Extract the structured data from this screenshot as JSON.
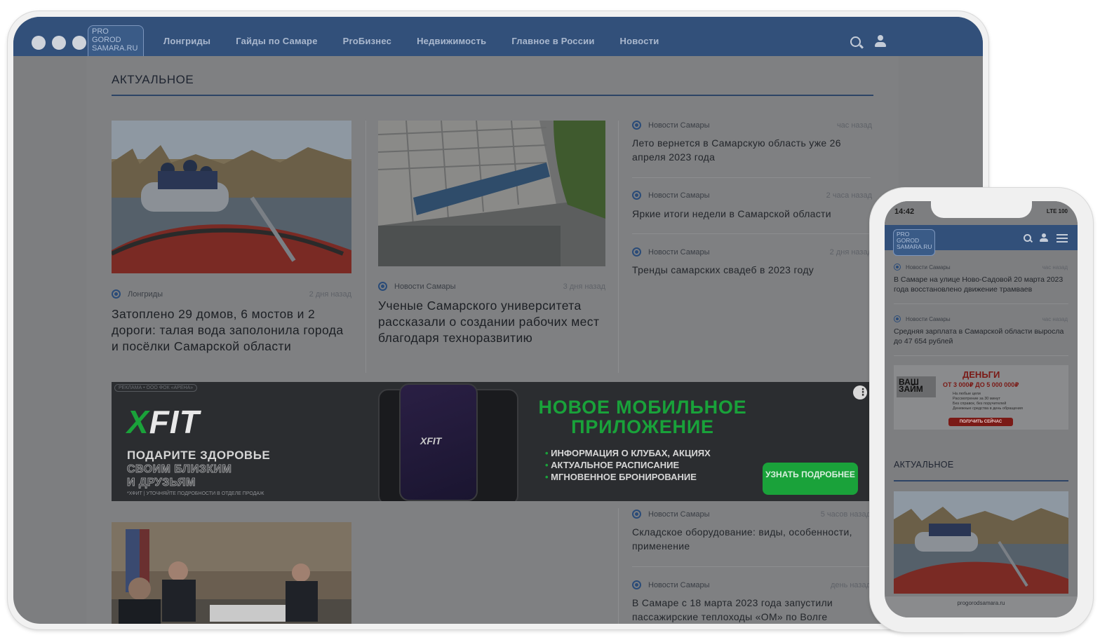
{
  "desktop": {
    "logo": "PRO GOROD SAMARA.RU",
    "nav": [
      "Лонгриды",
      "Гайды по Самаре",
      "ProБизнес",
      "Недвижимость",
      "Главное в России",
      "Новости"
    ],
    "section_title": "АКТУАЛЬНОЕ",
    "articles": [
      {
        "category": "Лонгриды",
        "time": "2 дня назад",
        "title": "Затоплено 29 домов, 6 мостов и 2 дороги: талая вода заполонила города и посёлки Самарской области"
      },
      {
        "category": "Новости Самары",
        "time": "3 дня назад",
        "title": "Ученые Самарского университета рассказали о создании рабочих мест благодаря техноразвитию"
      }
    ],
    "sidebar": [
      {
        "category": "Новости Самары",
        "time": "час назад",
        "title": "Лето вернется в Самарскую область уже 26 апреля 2023 года"
      },
      {
        "category": "Новости Самары",
        "time": "2 часа назад",
        "title": "Яркие итоги недели в Самарской области"
      },
      {
        "category": "Новости Самары",
        "time": "2 дня назад",
        "title": "Тренды самарских свадеб в 2023 году"
      },
      {
        "category": "Новости Самары",
        "time": "5 часов назад",
        "title": "Складское оборудование: виды, особенности, применение"
      },
      {
        "category": "Новости Самары",
        "time": "день назад",
        "title": "В Самаре с 18 марта 2023 года запустили пассажирские теплоходы «ОМ» по Волге"
      }
    ],
    "ad": {
      "label": "РЕКЛАМА • ООО ФОК «АРЕНА»",
      "brand_x": "X",
      "brand_rest": "FIT",
      "line1": "ПОДАРИТЕ ЗДОРОВЬЕ",
      "line2": "СВОИМ БЛИЗКИМ",
      "line3": "И ДРУЗЬЯМ",
      "fine": "*ХФИТ | УТОЧНЯЙТЕ ПОДРОБНОСТИ В ОТДЕЛЕ ПРОДАЖ",
      "headline": "НОВОЕ МОБИЛЬНОЕ ПРИЛОЖЕНИЕ",
      "bullets": [
        "ИНФОРМАЦИЯ О КЛУБАХ, АКЦИЯХ",
        "АКТУАЛЬНОЕ РАСПИСАНИЕ",
        "МГНОВЕННОЕ БРОНИРОВАНИЕ"
      ],
      "button": "УЗНАТЬ ПОДРОБНЕЕ",
      "app_logo": "XFIT"
    }
  },
  "phone": {
    "status_time": "14:42",
    "status_right": "LTE 100",
    "logo": "PRO GOROD SAMARA.RU",
    "items": [
      {
        "category": "Новости Самары",
        "time": "час назад",
        "title": "В Самаре на улице Ново-Садовой 20 марта 2023 года восстановлено движение трамваев"
      },
      {
        "category": "Новости Самары",
        "time": "час назад",
        "title": "Средняя зарплата в Самарской области выросла до 47 654 рублей"
      }
    ],
    "ad": {
      "logo": "ВАШ ЗАЙМ",
      "money": "ДЕНЬГИ",
      "range": "ОТ 3 000₽ ДО 5 000 000₽",
      "bullets": [
        "На любые цели",
        "Рассмотрение за 30 минут",
        "Без справок, без поручителей",
        "Денежные средства в день обращения"
      ],
      "button": "ПОЛУЧИТЬ СЕЙЧАС"
    },
    "section_title": "АКТУАЛЬНОЕ",
    "url": "progorodsamara.ru"
  },
  "colors": {
    "nav": "#32507a",
    "accent_green": "#1aa23a",
    "overlay_bg": "#7d7e80"
  }
}
